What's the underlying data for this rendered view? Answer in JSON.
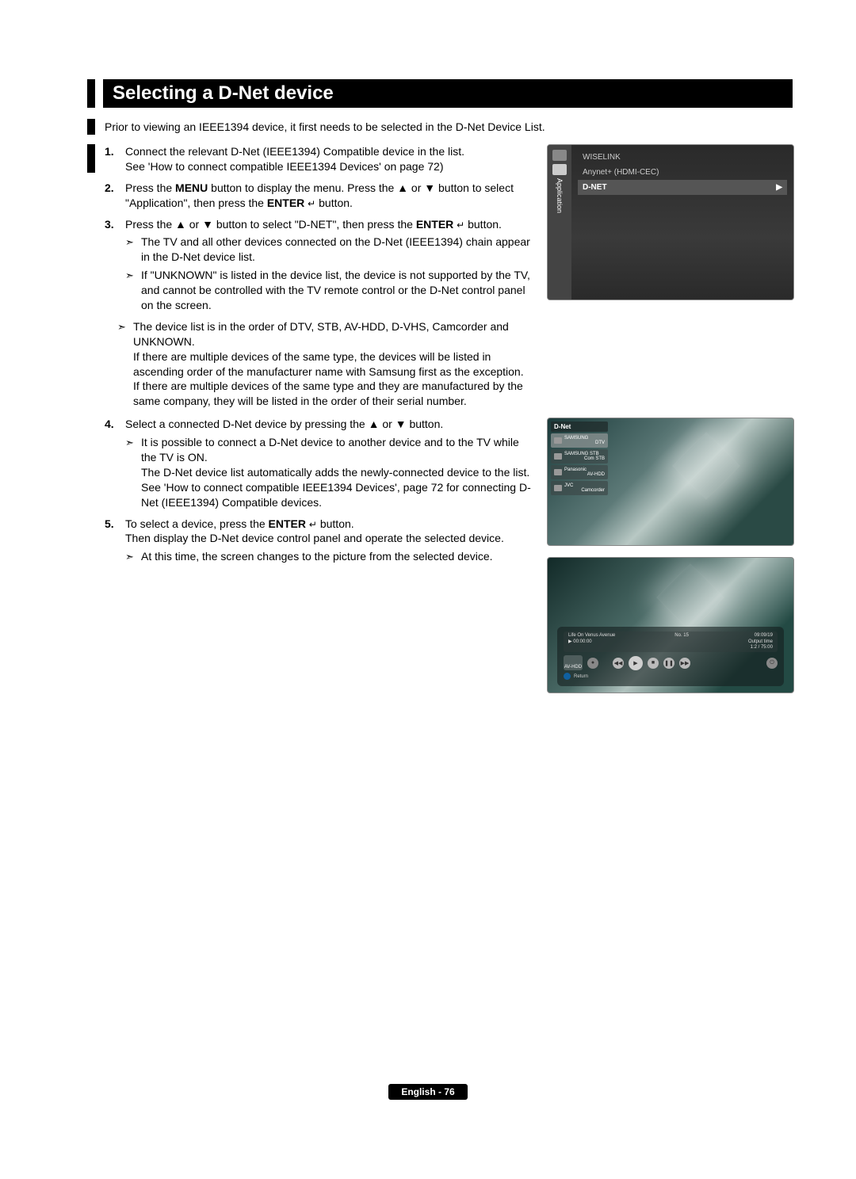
{
  "title": "Selecting a D-Net device",
  "intro": "Prior to viewing an IEEE1394 device, it first needs to be selected in the D-Net Device List.",
  "steps": {
    "s1": {
      "num": "1.",
      "t1": "Connect the relevant D-Net (IEEE1394) Compatible device in the list.",
      "t2": "See 'How to connect compatible IEEE1394 Devices' on page 72)"
    },
    "s2": {
      "num": "2.",
      "p1a": "Press the ",
      "p1b": "MENU",
      "p1c": " button to display the menu. Press the ▲ or ▼ button to select \"Application\", then press the ",
      "p1d": "ENTER",
      "p1e": " button."
    },
    "s3": {
      "num": "3.",
      "p1a": "Press the ▲ or ▼ button to select \"D-NET\", then press the ",
      "p1b": "ENTER",
      "p1c": " button.",
      "b1": "The TV and all other devices connected on the D-Net (IEEE1394) chain appear in the D-Net device list.",
      "b2": "If \"UNKNOWN\" is listed in the device list, the device is not supported by the TV, and cannot be controlled with the TV remote control or the D-Net control panel on the screen."
    },
    "note1": "The device list is in the order of DTV, STB, AV-HDD, D-VHS, Camcorder and UNKNOWN.\nIf there are multiple devices of the same type, the devices will be listed in ascending order of the manufacturer name with Samsung first as the exception. If there are multiple devices of the same type and they are manufactured by the same company, they will be listed in the order of their serial number.",
    "s4": {
      "num": "4.",
      "p1": "Select a connected D-Net device by pressing the ▲ or ▼ button.",
      "b1": "It is possible to connect a D-Net device to another device and to the TV while the TV is ON.",
      "t2": "The D-Net device list automatically adds the newly-connected device to the list.",
      "t3": "See 'How to connect compatible IEEE1394 Devices', page 72 for connecting D-Net (IEEE1394) Compatible devices."
    },
    "s5": {
      "num": "5.",
      "p1a": "To select a device, press the ",
      "p1b": "ENTER",
      "p1c": " button.",
      "t2": "Then display the D-Net device control panel and operate the selected device.",
      "b1": "At this time, the screen changes to the picture from the selected device."
    }
  },
  "menu_shot": {
    "side_label": "Application",
    "items": {
      "i1": "WISELINK",
      "i2": "Anynet+ (HDMI-CEC)",
      "i3": "D-NET"
    },
    "arrow": "▶"
  },
  "dev_shot": {
    "title": "D-Net",
    "items": {
      "d1a": "SAMSUNG",
      "d1b": "DTV",
      "d2a": "SAMSUNG STB",
      "d2b": "Com STB",
      "d3a": "Panasonic",
      "d3b": "AV-HDD",
      "d4a": "JVC",
      "d4b": "Camcorder"
    }
  },
  "ctrl_shot": {
    "title_left": "Life On Venus Avenue",
    "title_ch": "No. 15",
    "time_l": "▶  00:00:00",
    "time_r1": "09:09/19",
    "time_r2": "Output time",
    "time_r3": "1:2 / 75:00",
    "side": "AV-HDD",
    "foot": "Return"
  },
  "footer": "English - 76",
  "glyphs": {
    "enter": "↵",
    "bullet": "➣"
  }
}
